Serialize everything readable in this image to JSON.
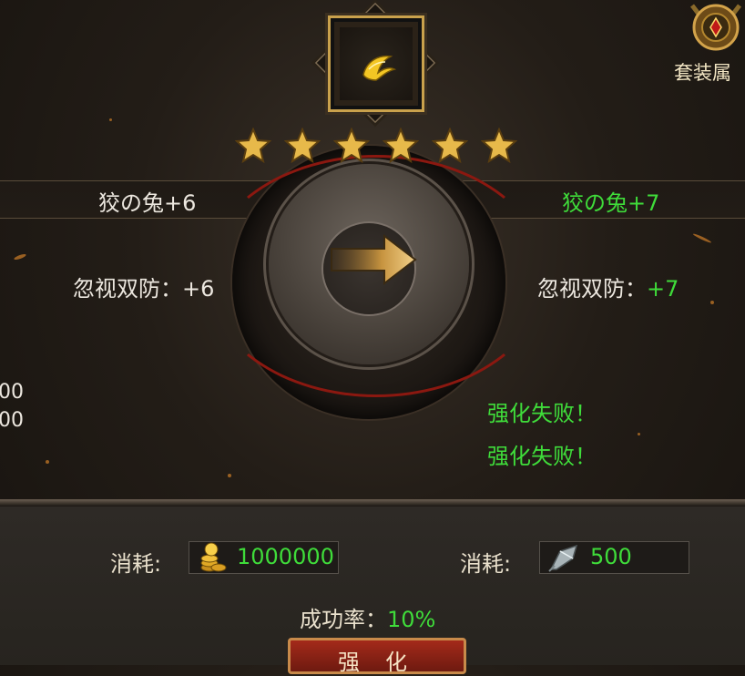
{
  "item": {
    "icon": "golden-wing-icon"
  },
  "stars": {
    "count": 6,
    "color": "#e7b94a"
  },
  "badge": {
    "label": "套装属",
    "icon": "medal-badge-icon"
  },
  "compare": {
    "name_before": "狡の兔+6",
    "name_after": "狡の兔+7",
    "stat_label": "忽视双防：",
    "stat_before": "+6",
    "stat_after": "+7"
  },
  "left_partial": [
    "00",
    "00"
  ],
  "log": [
    "强化失败！",
    "强化失败！"
  ],
  "cost": {
    "label1": "消耗:",
    "gold": "1000000",
    "label2": "消耗:",
    "stone": "500"
  },
  "success_rate": {
    "label": "成功率：",
    "value": "10%"
  },
  "button": {
    "label": "强化"
  },
  "colors": {
    "positive": "#3fdc3a",
    "gold_border": "#c9a14c",
    "button_red": "#a42a1a"
  }
}
